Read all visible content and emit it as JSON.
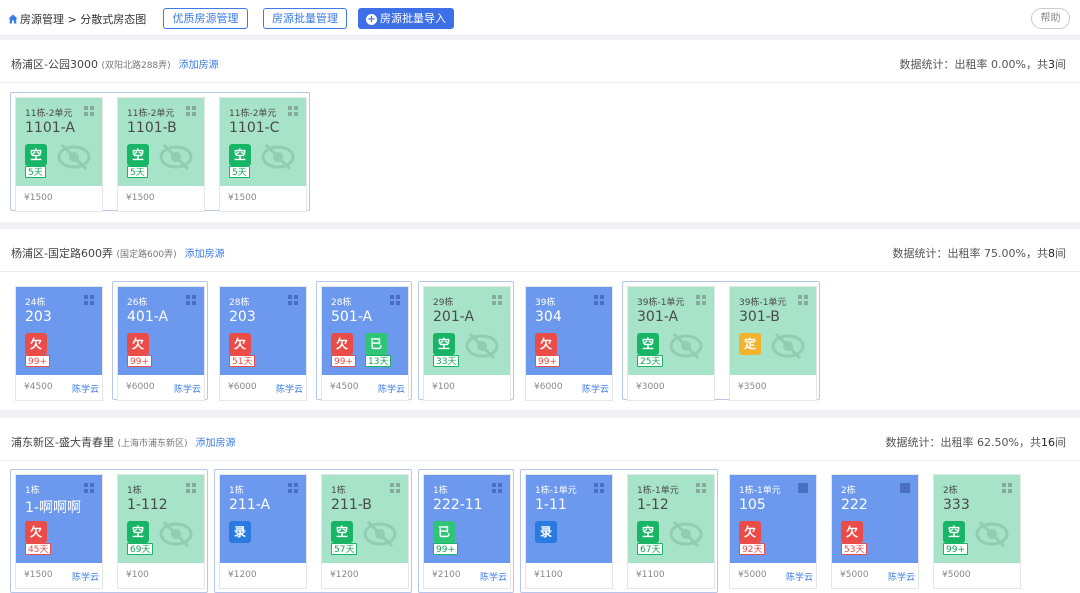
{
  "header": {
    "breadcrumb_root": "房源管理",
    "breadcrumb_sep": ">",
    "breadcrumb_current": "分散式房态图",
    "btn_quality": "优质房源管理",
    "btn_batch_manage": "房源批量管理",
    "btn_batch_import": "房源批量导入",
    "help": "帮助"
  },
  "sections": [
    {
      "name": "杨浦区-公园3000",
      "address": "(双阳北路288弄)",
      "add_label": "添加房源",
      "stat_prefix": "数据统计：出租率 0.00%，共",
      "stat_count": "3",
      "stat_suffix": "间",
      "cards": [
        {
          "building": "11栋-2单元",
          "room": "1101-A",
          "status": "空",
          "days": "5天",
          "price": "¥1500",
          "person": "",
          "color": "green"
        },
        {
          "building": "11栋-2单元",
          "room": "1101-B",
          "status": "空",
          "days": "5天",
          "price": "¥1500",
          "person": "",
          "color": "green"
        },
        {
          "building": "11栋-2单元",
          "room": "1101-C",
          "status": "空",
          "days": "5天",
          "price": "¥1500",
          "person": "",
          "color": "green"
        }
      ]
    },
    {
      "name": "杨浦区-国定路600弄",
      "address": "(国定路600弄)",
      "add_label": "添加房源",
      "stat_prefix": "数据统计：出租率 75.00%，共",
      "stat_count": "8",
      "stat_suffix": "间",
      "cards": [
        {
          "building": "24栋",
          "room": "203",
          "status": "欠",
          "days": "99+",
          "price": "¥4500",
          "person": "陈学云",
          "color": "blue"
        },
        {
          "building": "26栋",
          "room": "401-A",
          "status": "欠",
          "days": "99+",
          "price": "¥6000",
          "person": "陈学云",
          "color": "blue"
        },
        {
          "building": "28栋",
          "room": "203",
          "status": "欠",
          "days": "51天",
          "price": "¥6000",
          "person": "陈学云",
          "color": "blue"
        },
        {
          "building": "28栋",
          "room": "501-A",
          "status": "欠",
          "days": "99+",
          "status2": "已",
          "days2": "13天",
          "price": "¥4500",
          "person": "陈学云",
          "color": "blue"
        },
        {
          "building": "29栋",
          "room": "201-A",
          "status": "空",
          "days": "33天",
          "price": "¥100",
          "person": "",
          "color": "green"
        },
        {
          "building": "39栋",
          "room": "304",
          "status": "欠",
          "days": "99+",
          "price": "¥6000",
          "person": "陈学云",
          "color": "blue"
        },
        {
          "building": "39栋-1单元",
          "room": "301-A",
          "status": "空",
          "days": "25天",
          "price": "¥3000",
          "person": "",
          "color": "green"
        },
        {
          "building": "39栋-1单元",
          "room": "301-B",
          "status": "定",
          "days": "",
          "price": "¥3500",
          "person": "",
          "color": "green"
        }
      ]
    },
    {
      "name": "浦东新区-盛大青春里",
      "address": "(上海市浦东新区)",
      "add_label": "添加房源",
      "stat_prefix": "数据统计：出租率 62.50%，共",
      "stat_count": "16",
      "stat_suffix": "间",
      "cards": [
        {
          "building": "1栋",
          "room": "1-啊啊啊",
          "status": "欠",
          "days": "45天",
          "price": "¥1500",
          "person": "陈学云",
          "color": "blue"
        },
        {
          "building": "1栋",
          "room": "1-112",
          "status": "空",
          "days": "69天",
          "price": "¥100",
          "person": "",
          "color": "green"
        },
        {
          "building": "1栋",
          "room": "211-A",
          "status": "录",
          "days": "",
          "price": "¥1200",
          "person": "",
          "color": "blue"
        },
        {
          "building": "1栋",
          "room": "211-B",
          "status": "空",
          "days": "57天",
          "price": "¥1200",
          "person": "",
          "color": "green"
        },
        {
          "building": "1栋",
          "room": "222-11",
          "status": "已",
          "days": "99+",
          "price": "¥2100",
          "person": "陈学云",
          "color": "blue"
        },
        {
          "building": "1栋-1单元",
          "room": "1-11",
          "status": "录",
          "days": "",
          "price": "¥1100",
          "person": "",
          "color": "blue"
        },
        {
          "building": "1栋-1单元",
          "room": "1-12",
          "status": "空",
          "days": "67天",
          "price": "¥1100",
          "person": "",
          "color": "green"
        },
        {
          "building": "1栋-1单元",
          "room": "105",
          "status": "欠",
          "days": "92天",
          "price": "¥5000",
          "person": "陈学云",
          "color": "blue"
        },
        {
          "building": "2栋",
          "room": "222",
          "status": "欠",
          "days": "53天",
          "price": "¥5000",
          "person": "陈学云",
          "color": "blue"
        },
        {
          "building": "2栋",
          "room": "333",
          "status": "空",
          "days": "99+",
          "price": "¥5000",
          "person": "",
          "color": "green"
        }
      ]
    }
  ],
  "colors": {
    "green_card": "#a6e3c8",
    "blue_card": "#6c98ee",
    "accent": "#3d6fe6",
    "owe": "#ea4c48",
    "empty": "#18b566"
  }
}
